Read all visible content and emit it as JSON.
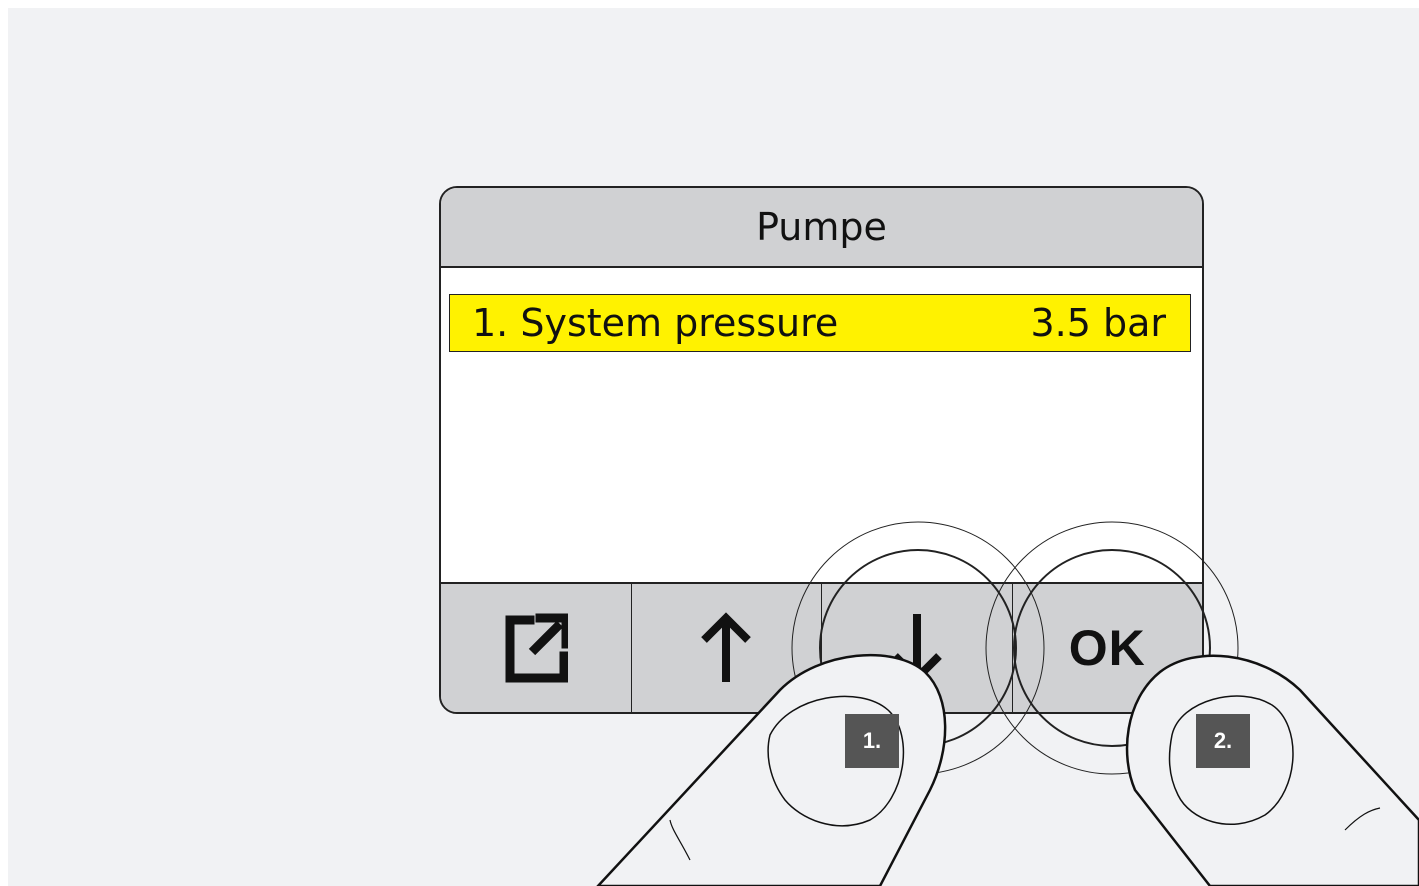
{
  "screen": {
    "title": "Pumpe",
    "menu_item": {
      "label": "1. System pressure",
      "value": "3.5 bar",
      "highlight_color": "#fff200"
    }
  },
  "buttons": [
    {
      "name": "external-link-icon"
    },
    {
      "name": "arrow-up-icon"
    },
    {
      "name": "arrow-down-icon"
    },
    {
      "label": "OK"
    }
  ],
  "steps": {
    "first": "1.",
    "second": "2."
  }
}
